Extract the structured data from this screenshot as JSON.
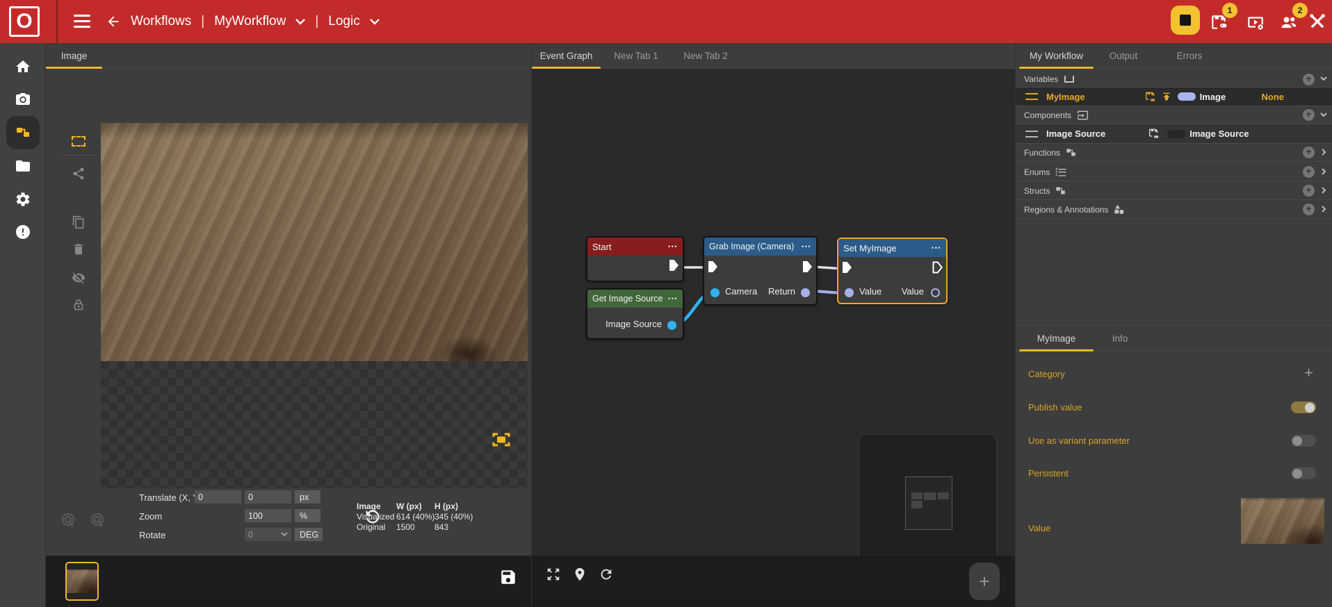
{
  "app": {
    "logo_letter": "O"
  },
  "header": {
    "nav": {
      "back_label": "Workflows",
      "separator": "|",
      "workflow_name": "MyWorkflow",
      "section_name": "Logic"
    },
    "actions": {
      "save_badge": "1",
      "users_badge": "2"
    },
    "color": "#c32b2b"
  },
  "sidebar": {
    "icons": [
      "home-icon",
      "camera-icon",
      "workflow-icon",
      "folder-icon",
      "settings-icon",
      "alert-icon"
    ],
    "active": "workflow-icon"
  },
  "image_panel": {
    "tab": "Image",
    "tools": [
      "marquee-select-icon",
      "share-icon",
      "copy-icon",
      "trash-icon",
      "eye-off-icon",
      "lock-icon"
    ],
    "controls": {
      "translate_label": "Translate (X, Y)",
      "translate_x": "0",
      "translate_y": "0",
      "translate_unit": "px",
      "zoom_label": "Zoom",
      "zoom_value": "100",
      "zoom_unit": "%",
      "rotate_label": "Rotate",
      "rotate_value": "0",
      "rotate_unit": "DEG"
    },
    "info": {
      "col_image": "Image",
      "col_w": "W (px)",
      "col_h": "H (px)",
      "rows": [
        {
          "name": "Visualized",
          "w": "614 (40%)",
          "h": "345 (40%)"
        },
        {
          "name": "Original",
          "w": "1500",
          "h": "843"
        }
      ]
    }
  },
  "graph_panel": {
    "tabs": [
      "Event Graph",
      "New Tab 1",
      "New Tab 2"
    ],
    "active_tab": "Event Graph",
    "nodes": {
      "start": {
        "title": "Start",
        "menu": "•••"
      },
      "grab": {
        "title": "Grab Image (Camera)",
        "menu": "•••",
        "input": "Camera",
        "output": "Return"
      },
      "set": {
        "title": "Set MyImage",
        "menu": "•••",
        "input": "Value",
        "output": "Value",
        "selected": true
      },
      "get": {
        "title": "Get Image Source",
        "menu": "•••",
        "output": "Image Source"
      }
    },
    "node_colors": {
      "start": "#871d1d",
      "grab": "#2b5b88",
      "set": "#2b5b88",
      "get": "#41663a",
      "selected_border": "#f2a71b"
    },
    "pin_colors": {
      "exec": "#ffffff",
      "image": "#2fb3f0",
      "value": "#a8b0ea"
    }
  },
  "right_panel": {
    "tabs": [
      "My Workflow",
      "Output",
      "Errors"
    ],
    "active_tab": "My Workflow",
    "sections": {
      "variables": "Variables",
      "components": "Components",
      "functions": "Functions",
      "enums": "Enums",
      "structs": "Structs",
      "regions": "Regions & Annotations"
    },
    "variable_row": {
      "name": "MyImage",
      "type": "Image",
      "value": "None"
    },
    "component_row": {
      "name": "Image Source",
      "type": "Image Source"
    },
    "details": {
      "tabs": [
        "MyImage",
        "Info"
      ],
      "active_tab": "MyImage",
      "fields": {
        "category": "Category",
        "publish": "Publish value",
        "variant": "Use as variant parameter",
        "persistent": "Persistent",
        "value": "Value"
      },
      "toggles": {
        "publish": "on",
        "variant": "off",
        "persistent": "off"
      }
    },
    "accent": "#f2b824"
  }
}
